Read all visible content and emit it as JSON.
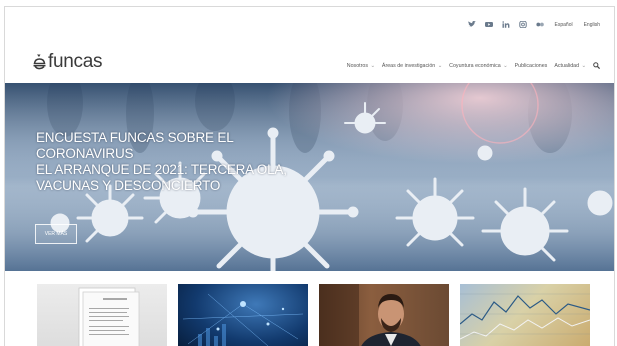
{
  "header": {
    "logo_text": "funcas",
    "social": [
      "twitter-icon",
      "youtube-icon",
      "linkedin-icon",
      "instagram-icon",
      "flickr-icon"
    ],
    "languages": [
      "Español",
      "English"
    ],
    "nav": [
      {
        "label": "Nosotros",
        "has_dropdown": true
      },
      {
        "label": "Áreas de investigación",
        "has_dropdown": true
      },
      {
        "label": "Coyuntura económica",
        "has_dropdown": true
      },
      {
        "label": "Publicaciones",
        "has_dropdown": false
      },
      {
        "label": "Actualidad",
        "has_dropdown": true
      }
    ],
    "dropdown_caret": "⌄"
  },
  "hero": {
    "title_lines": [
      "ENCUESTA FUNCAS SOBRE EL",
      "CORONAVIRUS",
      "EL ARRANQUE DE 2021: TERCERA OLA,",
      "VACUNAS Y DESCONCIERTO"
    ],
    "button_label": "VER MÁS"
  },
  "thumbnails": [
    {
      "name": "document-thumbnail"
    },
    {
      "name": "data-network-thumbnail"
    },
    {
      "name": "speaker-video-thumbnail"
    },
    {
      "name": "financial-chart-thumbnail"
    }
  ],
  "colors": {
    "text_dark": "#3a3a3a",
    "nav_text": "#555555",
    "hero_text": "#ffffff"
  }
}
